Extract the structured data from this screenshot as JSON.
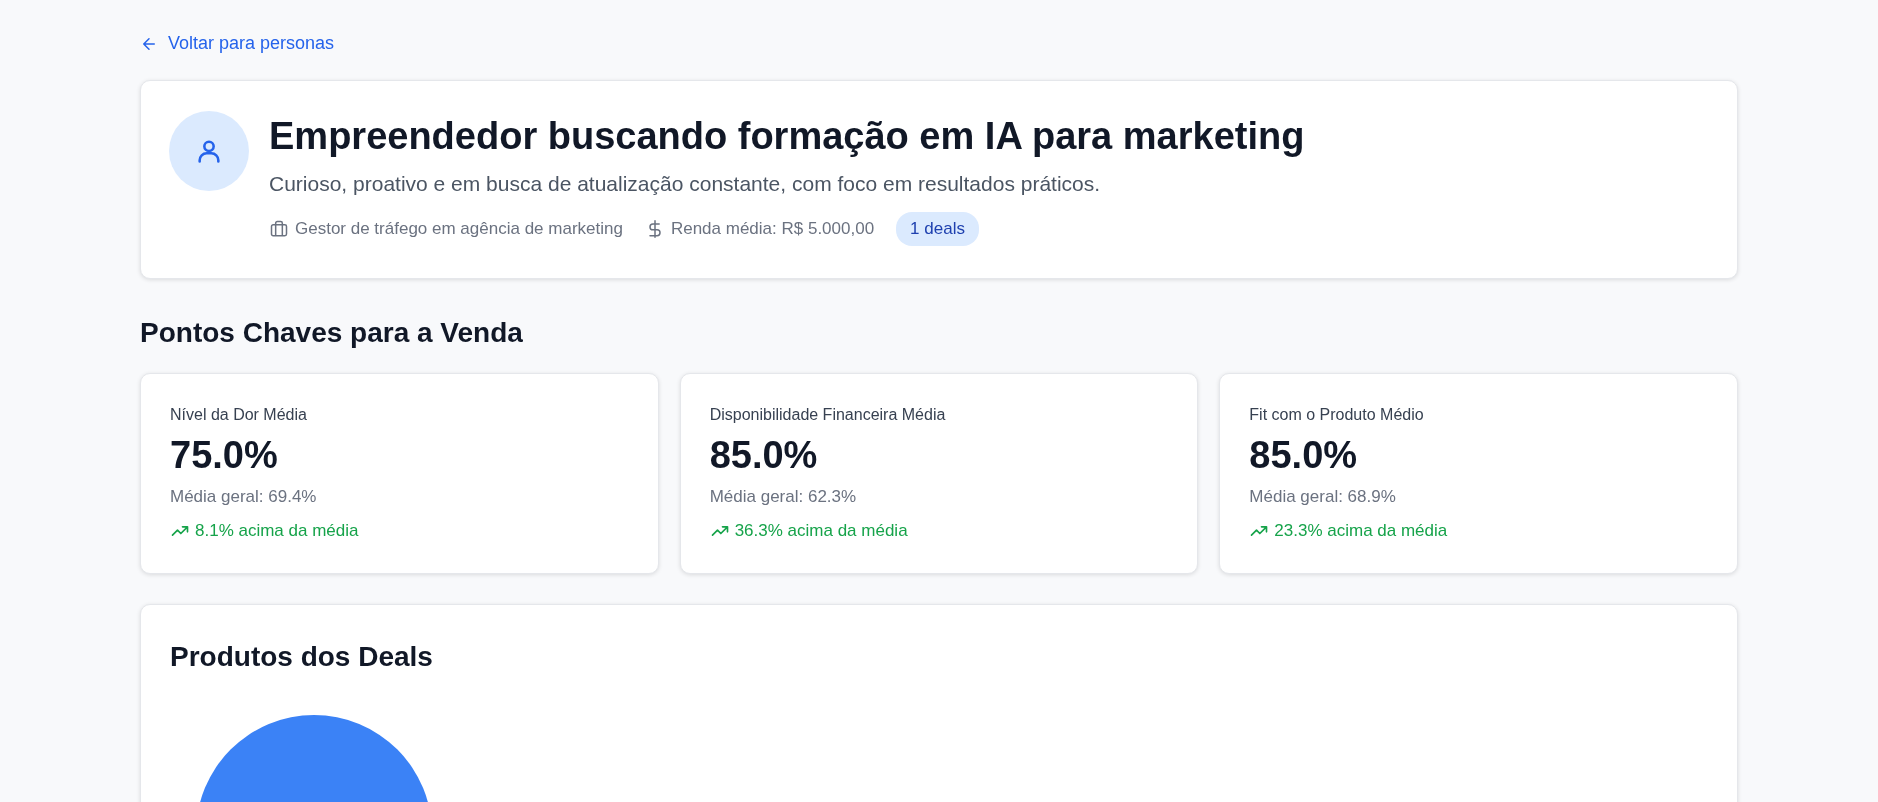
{
  "back_link": {
    "label": "Voltar para personas"
  },
  "persona": {
    "title": "Empreendedor buscando formação em IA para marketing",
    "description": "Curioso, proativo e em busca de atualização constante, com foco em resultados práticos.",
    "occupation": "Gestor de tráfego em agência de marketing",
    "income": "Renda média: R$ 5.000,00",
    "deals_badge": "1 deals"
  },
  "key_points": {
    "title": "Pontos Chaves para a Venda",
    "cards": [
      {
        "label": "Nível da Dor Média",
        "value": "75.0%",
        "average": "Média geral: 69.4%",
        "comparison": "8.1% acima da média",
        "kind": "up"
      },
      {
        "label": "Disponibilidade Financeira Média",
        "value": "85.0%",
        "average": "Média geral: 62.3%",
        "comparison": "36.3% acima da média",
        "kind": "up"
      },
      {
        "label": "Fit com o Produto Médio",
        "value": "85.0%",
        "average": "Média geral: 68.9%",
        "comparison": "23.3% acima da média",
        "kind": "up"
      }
    ]
  },
  "products": {
    "title": "Produtos dos Deals"
  }
}
